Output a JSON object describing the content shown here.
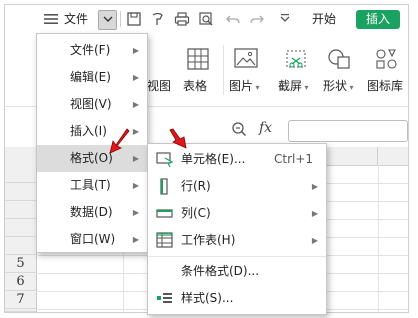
{
  "toolbar": {
    "menu_label": "文件",
    "start_tab": "开始",
    "insert_tab": "插入",
    "icons": [
      "hamburger-icon",
      "dropdown-icon",
      "save-icon",
      "format-painter-icon",
      "print-icon",
      "print-preview-icon",
      "undo-icon",
      "redo-icon",
      "customize-icon"
    ]
  },
  "ribbon": {
    "items": [
      "视图",
      "表格",
      "图片",
      "截屏",
      "形状",
      "图标库"
    ]
  },
  "formula_bar": {
    "zoom_icon": "zoom-icon",
    "fx_label": "fx",
    "value": ""
  },
  "sheet": {
    "row_numbers": [
      "5",
      "6",
      "7",
      "8"
    ]
  },
  "main_menu": {
    "items": [
      {
        "label": "文件(F)",
        "has_submenu": true
      },
      {
        "label": "编辑(E)",
        "has_submenu": true
      },
      {
        "label": "视图(V)",
        "has_submenu": true
      },
      {
        "label": "插入(I)",
        "has_submenu": true
      },
      {
        "label": "格式(O)",
        "has_submenu": true,
        "active": true
      },
      {
        "label": "工具(T)",
        "has_submenu": true
      },
      {
        "label": "数据(D)",
        "has_submenu": true
      },
      {
        "label": "窗口(W)",
        "has_submenu": true
      }
    ]
  },
  "format_submenu": {
    "items": [
      {
        "label": "单元格(E)...",
        "shortcut": "Ctrl+1",
        "icon": "cell-format-icon",
        "has_submenu": false
      },
      {
        "label": "行(R)",
        "icon": "row-icon",
        "has_submenu": true
      },
      {
        "label": "列(C)",
        "icon": "column-icon",
        "has_submenu": true
      },
      {
        "label": "工作表(H)",
        "icon": "worksheet-icon",
        "has_submenu": true
      },
      {
        "label": "条件格式(D)...",
        "icon": "",
        "has_submenu": false
      },
      {
        "label": "样式(S)...",
        "icon": "style-icon",
        "has_submenu": false
      }
    ]
  },
  "colors": {
    "accent": "#1aa260",
    "pointer": "#e0181c",
    "menu_hover": "#dcdcdc"
  }
}
